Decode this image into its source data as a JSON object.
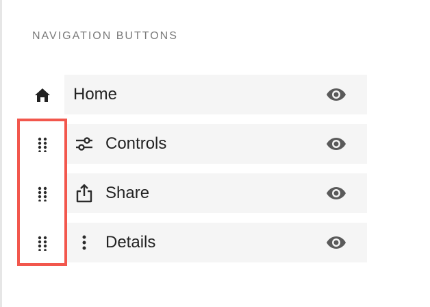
{
  "section": {
    "title": "NAVIGATION BUTTONS"
  },
  "items": [
    {
      "label": "Home",
      "leading_icon": "home-icon",
      "row_icon": "",
      "visibility_icon": "eye-icon"
    },
    {
      "label": "Controls",
      "leading_icon": "drag-handle-icon",
      "row_icon": "sliders-icon",
      "visibility_icon": "eye-icon"
    },
    {
      "label": "Share",
      "leading_icon": "drag-handle-icon",
      "row_icon": "share-icon",
      "visibility_icon": "eye-icon"
    },
    {
      "label": "Details",
      "leading_icon": "drag-handle-icon",
      "row_icon": "more-vertical-icon",
      "visibility_icon": "eye-icon"
    }
  ],
  "colors": {
    "highlight": "#f2574d",
    "row_background": "#f5f5f5",
    "icon": "#2b2b2b",
    "eye": "#5a5a5a"
  }
}
